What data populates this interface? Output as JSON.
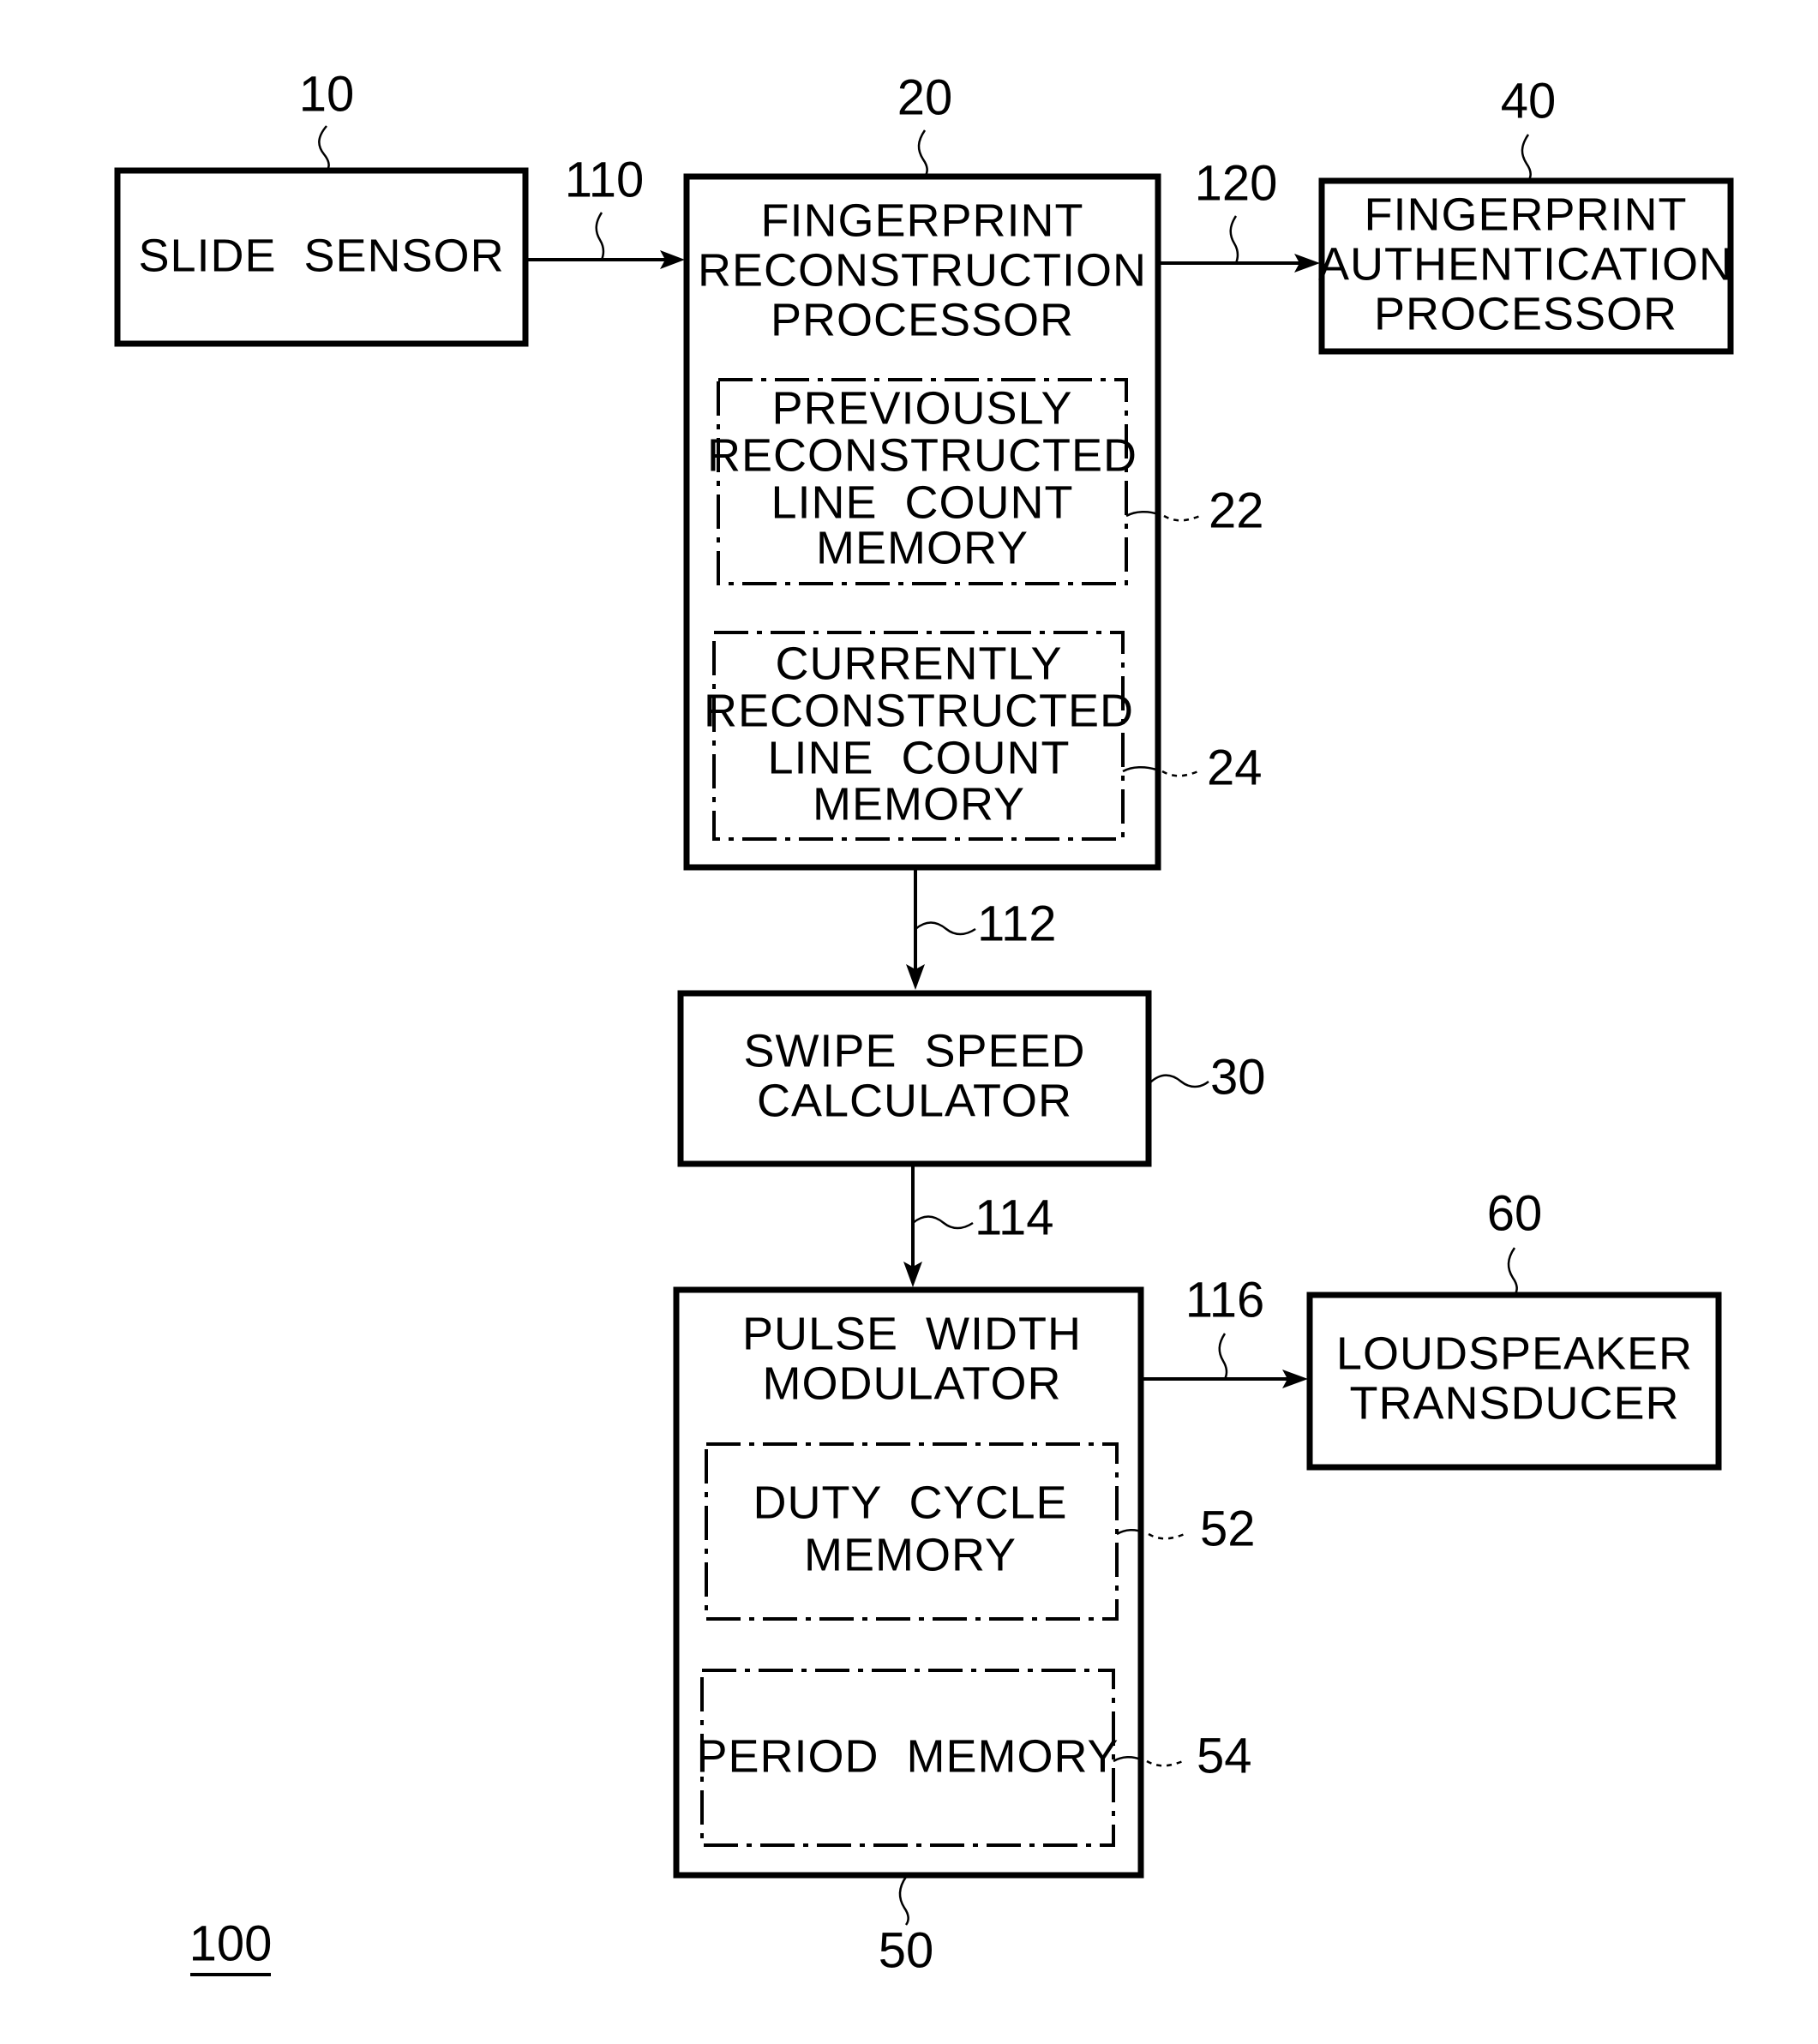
{
  "figure": {
    "reference": "100",
    "blocks": {
      "slide_sensor": {
        "ref": "10",
        "lines": [
          "SLIDE  SENSOR"
        ]
      },
      "fingerprint_reconstruction": {
        "ref": "20",
        "lines": [
          "FINGERPRINT",
          "RECONSTRUCTION",
          "PROCESSOR"
        ],
        "previous_memory": {
          "ref": "22",
          "lines": [
            "PREVIOUSLY",
            "RECONSTRUCTED",
            "LINE  COUNT",
            "MEMORY"
          ]
        },
        "current_memory": {
          "ref": "24",
          "lines": [
            "CURRENTLY",
            "RECONSTRUCTED",
            "LINE  COUNT",
            "MEMORY"
          ]
        }
      },
      "fingerprint_authentication": {
        "ref": "40",
        "lines": [
          "FINGERPRINT",
          "AUTHENTICATION",
          "PROCESSOR"
        ]
      },
      "swipe_speed_calculator": {
        "ref": "30",
        "lines": [
          "SWIPE  SPEED",
          "CALCULATOR"
        ]
      },
      "pulse_width_modulator": {
        "ref": "50",
        "lines": [
          "PULSE  WIDTH",
          "MODULATOR"
        ],
        "duty_cycle_memory": {
          "ref": "52",
          "lines": [
            "DUTY  CYCLE",
            "MEMORY"
          ]
        },
        "period_memory": {
          "ref": "54",
          "lines": [
            "PERIOD  MEMORY"
          ]
        }
      },
      "loudspeaker_transducer": {
        "ref": "60",
        "lines": [
          "LOUDSPEAKER",
          "TRANSDUCER"
        ]
      }
    },
    "signals": {
      "s110": "110",
      "s120": "120",
      "s112": "112",
      "s114": "114",
      "s116": "116"
    }
  }
}
